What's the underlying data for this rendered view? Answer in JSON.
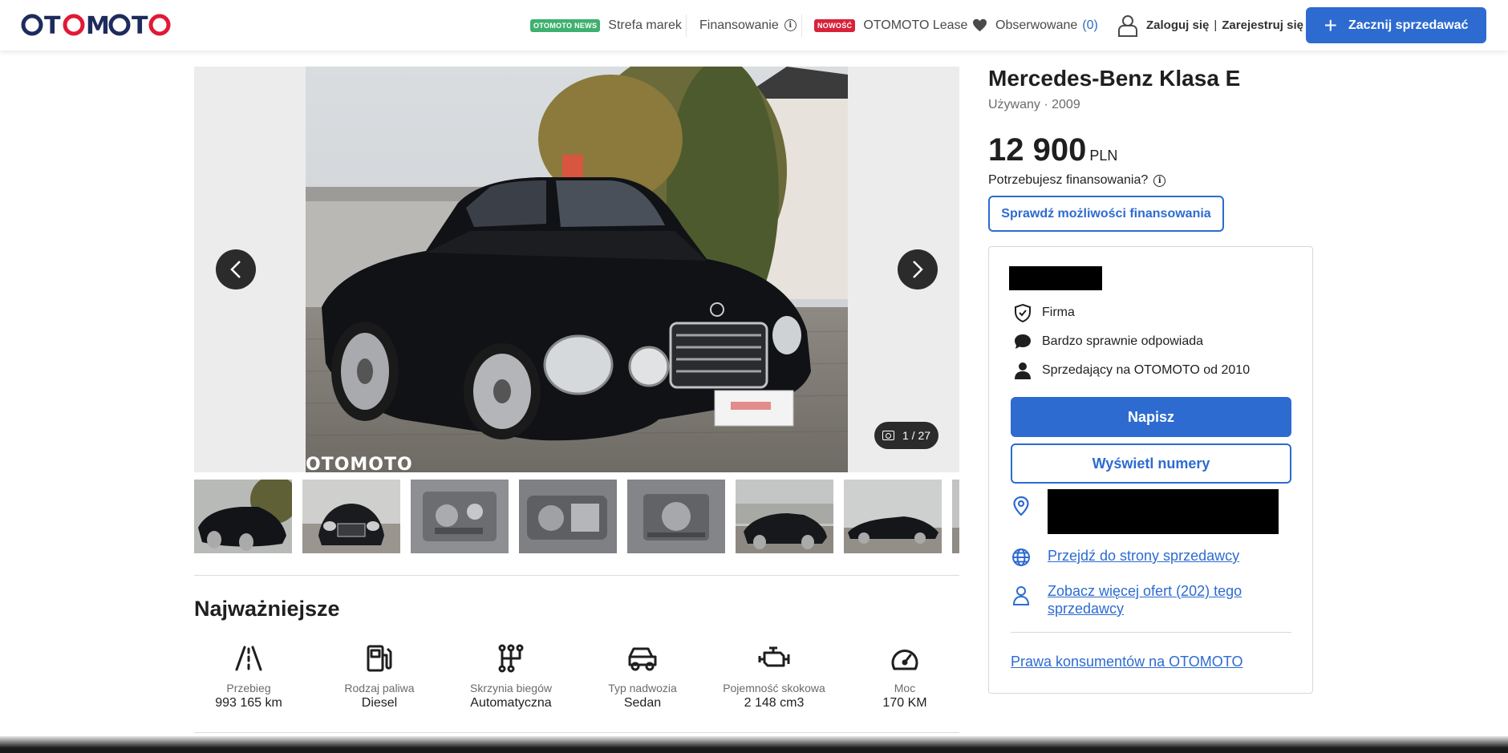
{
  "header": {
    "logo": "OTOMOTO",
    "news_badge": "OTOMOTO NEWS",
    "brand_zone": "Strefa marek",
    "financing": "Finansowanie",
    "new_badge": "NOWOŚĆ",
    "lease": "OTOMOTO Lease",
    "watched": "Obserwowane",
    "watched_count": "(0)",
    "login": "Zaloguj się",
    "separator": "|",
    "register": "Zarejestruj się",
    "sell_button": "Zacznij sprzedawać"
  },
  "gallery": {
    "counter": "1 / 27",
    "watermark": "OTOMOTO",
    "thumbnail_count": 8
  },
  "listing": {
    "title": "Mercedes-Benz Klasa E",
    "subtitle": "Używany · 2009",
    "price": "12 900",
    "currency": "PLN",
    "financing_question": "Potrzebujesz finansowania?",
    "financing_button": "Sprawdź możliwości finansowania"
  },
  "highlights": {
    "title": "Najważniejsze",
    "items": [
      {
        "label": "Przebieg",
        "value": "993 165 km",
        "icon": "road-icon"
      },
      {
        "label": "Rodzaj paliwa",
        "value": "Diesel",
        "icon": "fuel-pump-icon"
      },
      {
        "label": "Skrzynia biegów",
        "value": "Automatyczna",
        "icon": "gearbox-icon"
      },
      {
        "label": "Typ nadwozia",
        "value": "Sedan",
        "icon": "car-body-icon"
      },
      {
        "label": "Pojemność skokowa",
        "value": "2 148 cm3",
        "icon": "engine-icon"
      },
      {
        "label": "Moc",
        "value": "170 KM",
        "icon": "speedometer-icon"
      }
    ]
  },
  "seller": {
    "type": "Firma",
    "response": "Bardzo sprawnie odpowiada",
    "since": "Sprzedający na OTOMOTO od 2010",
    "message_button": "Napisz",
    "show_numbers_button": "Wyświetl numery",
    "seller_page_link": "Przejdź do strony sprzedawcy",
    "more_offers_link": "Zobacz więcej ofert (202) tego sprzedawcy",
    "consumer_rights_link": "Prawa konsumentów na OTOMOTO"
  },
  "colors": {
    "brand_blue": "#2d6bd0",
    "logo_navy": "#1d2c5c",
    "logo_red": "#e21836",
    "news_green": "#3fb06f",
    "new_red": "#d8223a"
  }
}
